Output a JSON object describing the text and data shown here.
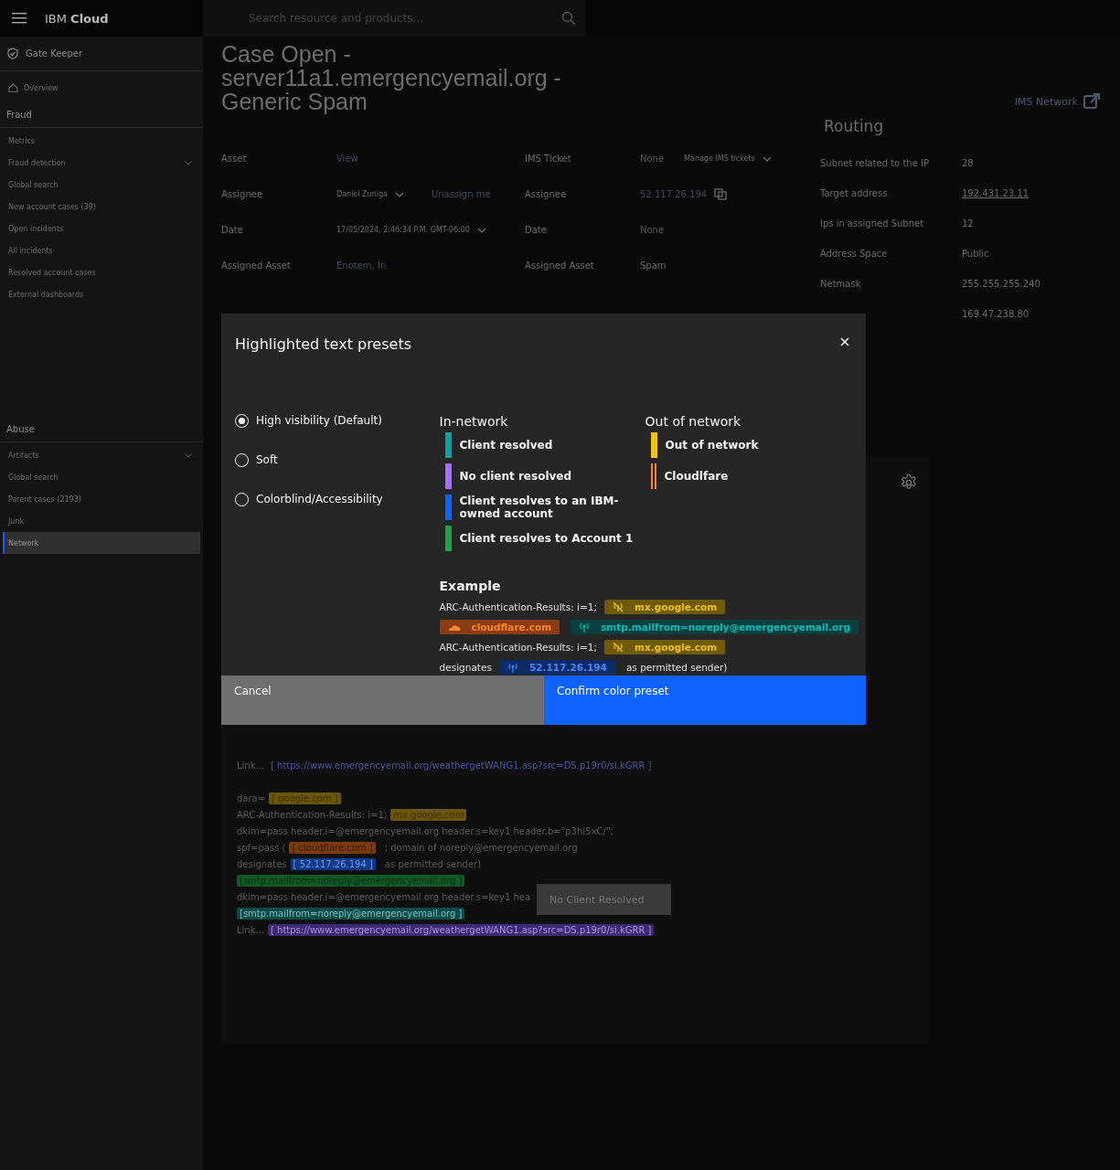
{
  "header": {
    "brand": "IBM **Cloud**",
    "search": {
      "placeholder": "Search resource and products..."
    }
  },
  "sidebar": {
    "app": "Gate Keeper",
    "overview": {
      "label": "Overview",
      "selected": false
    },
    "sections": [
      {
        "title": "Fraud",
        "items": [
          {
            "label": "Metrics",
            "selected": false
          },
          {
            "label": "Fraud detection",
            "selected": false,
            "expanded": false
          },
          {
            "label": "Global search",
            "selected": false
          },
          {
            "label": "New account cases (39)",
            "selected": false
          },
          {
            "label": "Open incidents",
            "selected": false
          },
          {
            "label": "All incidents",
            "selected": false
          },
          {
            "label": "Resolved account cases",
            "selected": false
          },
          {
            "label": "External dashboards",
            "selected": false
          }
        ]
      },
      {
        "title": "Abuse",
        "items": [
          {
            "label": "Artifacts",
            "selected": false,
            "expanded": false
          },
          {
            "label": "Global search",
            "selected": false
          },
          {
            "label": "Parent cases (2193)",
            "selected": false
          },
          {
            "label": "Junk",
            "selected": false
          },
          {
            "label": "Network",
            "selected": true
          }
        ]
      }
    ]
  },
  "case": {
    "title": "Case Open - server11a1.emergencyemail.org - Generic Spam",
    "ims_link": "IMS Network",
    "fields_left": [
      {
        "label": "Asset",
        "value": "View",
        "kind": "link"
      },
      {
        "label": "Assignee",
        "value": "Daniel Zuniga",
        "kind": "dropdown",
        "action": "Unassign me"
      },
      {
        "label": "Date",
        "value": "17/05/2024, 2:46:34 P.M. GMT-06:00",
        "kind": "dropdown"
      },
      {
        "label": "Assigned Asset",
        "value": "Enotem, In",
        "kind": "link"
      }
    ],
    "fields_right": [
      {
        "label": "IMS Ticket",
        "value": "None",
        "kind": "muted",
        "action": "Manage IMS tickets"
      },
      {
        "label": "Assignee",
        "value": "52.117.26.194",
        "kind": "copy"
      },
      {
        "label": "Date",
        "value": "None",
        "kind": "muted"
      },
      {
        "label": "Assigned Asset",
        "value": "Spam",
        "kind": "plain"
      }
    ],
    "routing": {
      "title": "Routing",
      "rows": [
        {
          "label": "Subnet related to the IP",
          "value": "28",
          "kind": "plain"
        },
        {
          "label": "Target address",
          "value": "192.431.23.11",
          "kind": "link"
        },
        {
          "label": "Ips in assigned Subnet",
          "value": "12",
          "kind": "plain"
        },
        {
          "label": "Address Space",
          "value": "Public",
          "kind": "plain"
        },
        {
          "label": "Netmask",
          "value": "255.255.255.240",
          "kind": "plain"
        },
        {
          "value": "169.47.238.80",
          "kind": "plain"
        }
      ]
    }
  },
  "email_panel": {
    "blocks": [
      [
        [
          {
            "text": "Link...",
            "kind": "plain"
          },
          {
            "text": "[ https://www.emergencyemail.org/weathergetWANG1.asp?src=DS.p19r0/si.kGRR ]",
            "kind": "link"
          }
        ]
      ],
      [
        [
          {
            "text": "dara=",
            "kind": "plain"
          },
          {
            "text": "[ google.com ]",
            "kind": "out"
          }
        ],
        [
          {
            "text": "ARC-Authentication-Results: i=1;",
            "kind": "plain"
          },
          {
            "text": "mx.google.com",
            "kind": "out"
          }
        ],
        [
          {
            "text": "dkim=pass header.i=@emergencyemail.org header.s=key1 header.b=\"p3hI5xC/\";",
            "kind": "plain"
          }
        ],
        [
          {
            "text": "spf=pass (",
            "kind": "plain"
          },
          {
            "text": "[ cloudflare.com ]",
            "kind": "cloudflare"
          },
          {
            "text": "; domain of noreply@emergencyemail.org",
            "kind": "plain"
          }
        ],
        [
          {
            "text": "designates",
            "kind": "plain"
          },
          {
            "text": "[ 52.117.26.194 ]",
            "kind": "ibm"
          },
          {
            "text": "as permitted sender)",
            "kind": "plain"
          }
        ],
        [
          {
            "text": "[smtp.mailfrom=noreply@emergencyemail.org ]",
            "kind": "account"
          }
        ],
        [
          {
            "text": "dkim=pass header.i=@emergencyemail.org header.s=key1 hea",
            "kind": "plain"
          }
        ],
        [
          {
            "text": "[smtp.mailfrom=noreply@emergencyemail.org ]",
            "kind": "client"
          }
        ],
        [
          {
            "text": "Link...",
            "kind": "plain"
          },
          {
            "text": "[ https://www.emergencyemail.org/weathergetWANG1.asp?src=DS.p19r0/si.kGRR ]",
            "kind": "noclient"
          }
        ]
      ]
    ],
    "tooltip": "No Client Resolved"
  },
  "modal": {
    "title": "Highlighted text presets",
    "presets": [
      {
        "label": "High visibility (Default)",
        "selected": true
      },
      {
        "label": "Soft",
        "selected": false
      },
      {
        "label": "Colorblind/Accessibility",
        "selected": false
      }
    ],
    "legend": [
      {
        "title": "In-network",
        "items": [
          {
            "label": "Client resolved",
            "color": "#08a39c",
            "kind": "solid"
          },
          {
            "label": "No client resolved",
            "color": "#a56eff",
            "kind": "solid"
          },
          {
            "label": "Client resolves to an IBM-owned account",
            "color": "#0f62fe",
            "kind": "solid"
          },
          {
            "label": "Client resolves to Account 1",
            "color": "#24a148",
            "kind": "solid"
          }
        ]
      },
      {
        "title": "Out of network",
        "items": [
          {
            "label": "Out of network",
            "color": "#f1c21b",
            "kind": "solid"
          },
          {
            "label": "Cloudlfare",
            "color": "#ff832b",
            "kind": "double"
          }
        ]
      }
    ],
    "example_title": "Example",
    "example": [
      [
        {
          "text": "ARC-Authentication-Results: i=1;",
          "kind": "plain"
        },
        {
          "text": "mx.google.com",
          "kind": "out"
        }
      ],
      [
        {
          "text": "cloudflare.com",
          "kind": "cloudflare"
        },
        {
          "text": "smtp.mailfrom=noreply@emergencyemail.org",
          "kind": "client"
        }
      ],
      [
        {
          "text": "ARC-Authentication-Results: i=1;",
          "kind": "plain"
        },
        {
          "text": "mx.google.com",
          "kind": "out"
        }
      ],
      [
        {
          "text": "designates",
          "kind": "plain"
        },
        {
          "text": "52.117.26.194",
          "kind": "ibm"
        },
        {
          "text": "as permitted sender)",
          "kind": "plain"
        }
      ]
    ],
    "buttons": [
      {
        "label": "Cancel",
        "kind": "secondary"
      },
      {
        "label": "Confirm color preset",
        "kind": "primary"
      }
    ]
  }
}
